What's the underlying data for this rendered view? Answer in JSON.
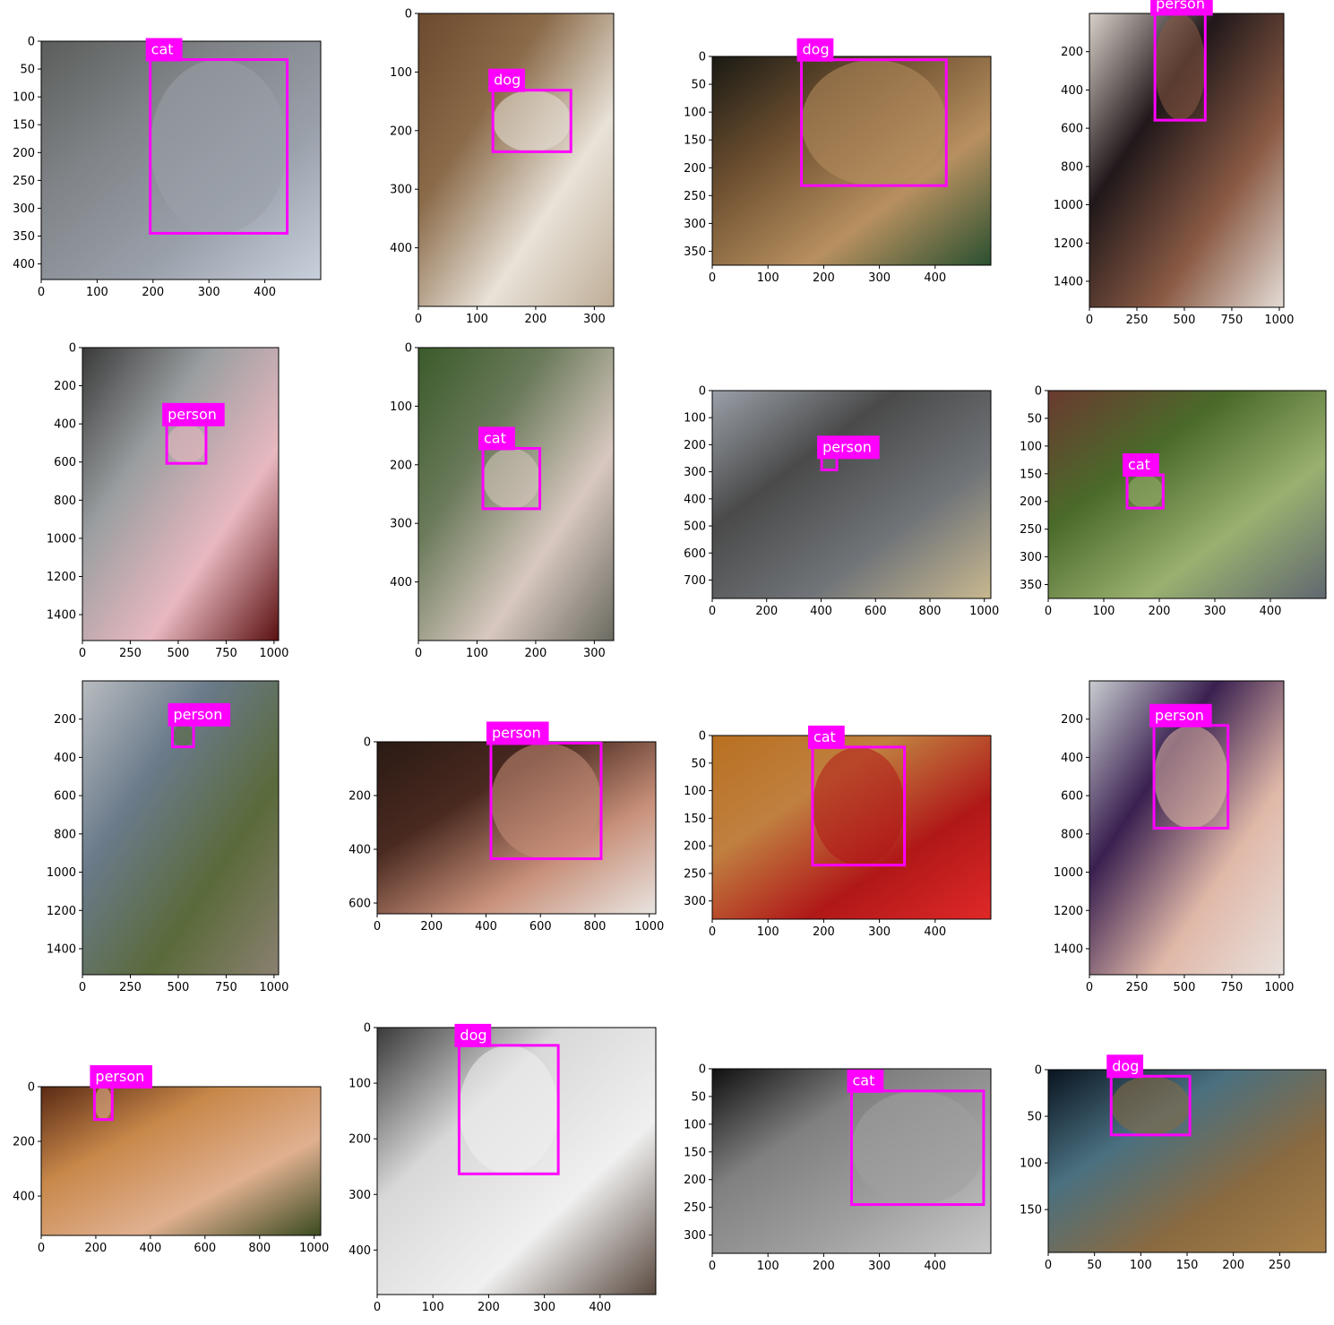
{
  "colors": {
    "box": "#ff00ff",
    "label_text": "#ffffff"
  },
  "panels": [
    {
      "label": "cat",
      "xlim": [
        0,
        500
      ],
      "ylim": [
        428,
        0
      ],
      "xticks": [
        0,
        100,
        200,
        300,
        400
      ],
      "yticks": [
        0,
        50,
        100,
        150,
        200,
        250,
        300,
        350,
        400
      ],
      "box": [
        195,
        33,
        440,
        345
      ],
      "palette": [
        "#5a5d5a",
        "#808488",
        "#9aa0aa",
        "#c8d0dc"
      ]
    },
    {
      "label": "dog",
      "xlim": [
        0,
        333
      ],
      "ylim": [
        500,
        0
      ],
      "xticks": [
        0,
        100,
        200,
        300
      ],
      "yticks": [
        0,
        100,
        200,
        300,
        400
      ],
      "box": [
        127,
        131,
        260,
        236
      ],
      "palette": [
        "#6b4a2e",
        "#8a6a48",
        "#e8e2d8",
        "#bfae98"
      ]
    },
    {
      "label": "dog",
      "xlim": [
        0,
        500
      ],
      "ylim": [
        375,
        0
      ],
      "xticks": [
        0,
        100,
        200,
        300,
        400
      ],
      "yticks": [
        0,
        50,
        100,
        150,
        200,
        250,
        300,
        350
      ],
      "box": [
        160,
        6,
        420,
        232
      ],
      "palette": [
        "#1a1a14",
        "#6e5030",
        "#b89060",
        "#2a5030"
      ]
    },
    {
      "label": "person",
      "xlim": [
        0,
        1024
      ],
      "ylim": [
        1536,
        0
      ],
      "xticks": [
        0,
        250,
        500,
        750,
        1000
      ],
      "yticks": [
        200,
        400,
        600,
        800,
        1000,
        1200,
        1400
      ],
      "box": [
        345,
        2,
        610,
        558
      ],
      "palette": [
        "#d8d0c8",
        "#20181a",
        "#8a5a44",
        "#e4dcd6"
      ]
    },
    {
      "label": "person",
      "xlim": [
        0,
        1024
      ],
      "ylim": [
        1536,
        0
      ],
      "xticks": [
        0,
        250,
        500,
        750,
        1000
      ],
      "yticks": [
        0,
        200,
        400,
        600,
        800,
        1000,
        1200,
        1400
      ],
      "box": [
        440,
        403,
        645,
        607
      ],
      "palette": [
        "#3a3a3a",
        "#9a9ea0",
        "#e8b8c0",
        "#5a1010"
      ]
    },
    {
      "label": "cat",
      "xlim": [
        0,
        333
      ],
      "ylim": [
        500,
        0
      ],
      "xticks": [
        0,
        100,
        200,
        300
      ],
      "yticks": [
        0,
        100,
        200,
        300,
        400
      ],
      "box": [
        110,
        172,
        207,
        275
      ],
      "palette": [
        "#3a5a2a",
        "#6a7a5a",
        "#d8c8c0",
        "#6a6a60"
      ]
    },
    {
      "label": "person",
      "xlim": [
        0,
        1024
      ],
      "ylim": [
        768,
        0
      ],
      "xticks": [
        0,
        200,
        400,
        600,
        800,
        1000
      ],
      "yticks": [
        0,
        100,
        200,
        300,
        400,
        500,
        600,
        700
      ],
      "box": [
        402,
        246,
        458,
        293
      ],
      "palette": [
        "#9aa0a8",
        "#4a4a4a",
        "#707478",
        "#c8b890"
      ]
    },
    {
      "label": "cat",
      "xlim": [
        0,
        500
      ],
      "ylim": [
        375,
        0
      ],
      "xticks": [
        0,
        100,
        200,
        300,
        400
      ],
      "yticks": [
        0,
        50,
        100,
        150,
        200,
        250,
        300,
        350
      ],
      "box": [
        142,
        152,
        207,
        212
      ],
      "palette": [
        "#6a3a30",
        "#4a6a2a",
        "#9ab070",
        "#606870"
      ]
    },
    {
      "label": "person",
      "xlim": [
        0,
        1024
      ],
      "ylim": [
        1536,
        0
      ],
      "xticks": [
        0,
        250,
        500,
        750,
        1000
      ],
      "yticks": [
        200,
        400,
        600,
        800,
        1000,
        1200,
        1400
      ],
      "box": [
        470,
        229,
        580,
        345
      ],
      "palette": [
        "#b8bcc0",
        "#6a7a8a",
        "#5a6a3a",
        "#8a8070"
      ]
    },
    {
      "label": "person",
      "xlim": [
        0,
        1024
      ],
      "ylim": [
        640,
        0
      ],
      "xticks": [
        0,
        200,
        400,
        600,
        800,
        1000
      ],
      "yticks": [
        0,
        200,
        400,
        600
      ],
      "box": [
        418,
        5,
        823,
        435
      ],
      "palette": [
        "#2a1a14",
        "#4a2a20",
        "#c8907a",
        "#e8e4e0"
      ]
    },
    {
      "label": "cat",
      "xlim": [
        0,
        500
      ],
      "ylim": [
        333,
        0
      ],
      "xticks": [
        0,
        100,
        200,
        300,
        400
      ],
      "yticks": [
        0,
        50,
        100,
        150,
        200,
        250,
        300
      ],
      "box": [
        180,
        21,
        345,
        235
      ],
      "palette": [
        "#b87020",
        "#c08040",
        "#b01818",
        "#e02828"
      ]
    },
    {
      "label": "person",
      "xlim": [
        0,
        1024
      ],
      "ylim": [
        1536,
        0
      ],
      "xticks": [
        0,
        250,
        500,
        750,
        1000
      ],
      "yticks": [
        200,
        400,
        600,
        800,
        1000,
        1200,
        1400
      ],
      "box": [
        340,
        233,
        730,
        770
      ],
      "palette": [
        "#c8ccd0",
        "#3a2050",
        "#e0b8a8",
        "#e8e0dc"
      ]
    },
    {
      "label": "person",
      "xlim": [
        0,
        1024
      ],
      "ylim": [
        544,
        0
      ],
      "xticks": [
        0,
        200,
        400,
        600,
        800,
        1000
      ],
      "yticks": [
        0,
        200,
        400
      ],
      "box": [
        195,
        0,
        260,
        120
      ],
      "palette": [
        "#5a2a14",
        "#c8884a",
        "#e0b090",
        "#3a4a20"
      ]
    },
    {
      "label": "dog",
      "xlim": [
        0,
        500
      ],
      "ylim": [
        480,
        0
      ],
      "xticks": [
        0,
        100,
        200,
        300,
        400
      ],
      "yticks": [
        0,
        100,
        200,
        300,
        400
      ],
      "box": [
        147,
        32,
        325,
        263
      ],
      "palette": [
        "#3a3a3a",
        "#d8d8d8",
        "#f0f0f0",
        "#5a4a40"
      ]
    },
    {
      "label": "cat",
      "xlim": [
        0,
        500
      ],
      "ylim": [
        333,
        0
      ],
      "xticks": [
        0,
        100,
        200,
        300,
        400
      ],
      "yticks": [
        0,
        50,
        100,
        150,
        200,
        250,
        300
      ],
      "box": [
        250,
        40,
        487,
        245
      ],
      "palette": [
        "#101010",
        "#808080",
        "#a0a0a0",
        "#c8c8c8"
      ]
    },
    {
      "label": "dog",
      "xlim": [
        0,
        300
      ],
      "ylim": [
        196,
        0
      ],
      "xticks": [
        0,
        50,
        100,
        150,
        200,
        250
      ],
      "yticks": [
        0,
        50,
        100,
        150
      ],
      "box": [
        68,
        7,
        153,
        70
      ],
      "palette": [
        "#0a1420",
        "#4a7080",
        "#8a6a40",
        "#a88048"
      ]
    }
  ]
}
